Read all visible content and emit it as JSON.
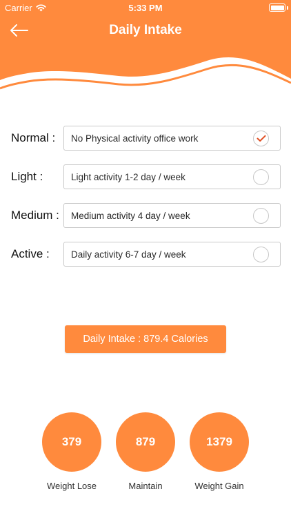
{
  "status_bar": {
    "carrier": "Carrier",
    "time": "5:33 PM",
    "battery_level": 1.0
  },
  "header": {
    "title": "Daily Intake",
    "back_icon": "arrow-left-icon",
    "bg_color": "#ff8a3d"
  },
  "activity_levels": [
    {
      "label": "Normal :",
      "description": "No Physical activity office work",
      "selected": true
    },
    {
      "label": "Light :",
      "description": "Light activity 1-2 day / week",
      "selected": false
    },
    {
      "label": "Medium :",
      "description": "Medium activity 4 day / week",
      "selected": false
    },
    {
      "label": "Active :",
      "description": "Daily activity 6-7 day / week",
      "selected": false
    }
  ],
  "intake_button": {
    "label": "Daily Intake : 879.4 Calories"
  },
  "goals": [
    {
      "value": "379",
      "label": "Weight Lose"
    },
    {
      "value": "879",
      "label": "Maintain"
    },
    {
      "value": "1379",
      "label": "Weight Gain"
    }
  ],
  "colors": {
    "accent": "#ff8a3d",
    "check": "#e04e22"
  }
}
